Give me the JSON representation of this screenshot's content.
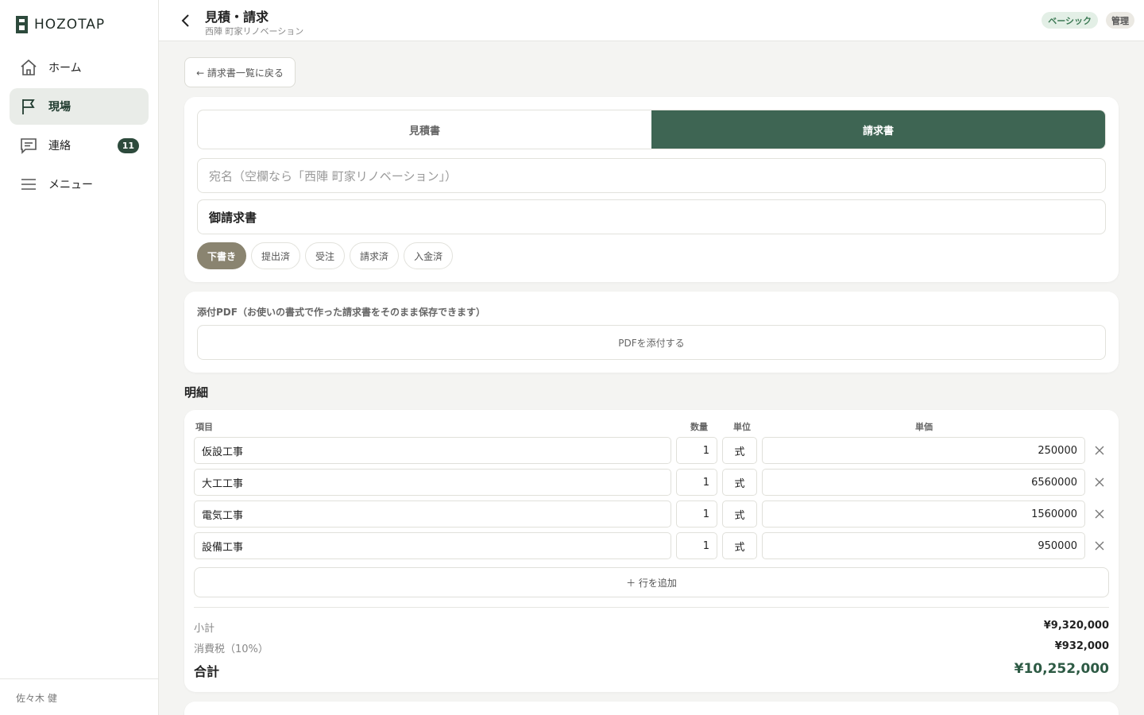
{
  "app": {
    "logo_text": "HOZOTAP"
  },
  "sidebar": {
    "items": [
      {
        "label": "ホーム",
        "icon": "home-icon"
      },
      {
        "label": "現場",
        "icon": "flag-icon",
        "active": true
      },
      {
        "label": "連絡",
        "icon": "chat-icon",
        "badge": "11"
      },
      {
        "label": "メニュー",
        "icon": "menu-icon"
      }
    ],
    "user": "佐々木 健"
  },
  "header": {
    "title": "見積・請求",
    "subtitle": "西陣 町家リノベーション",
    "plan_badge": "ベーシック",
    "admin_badge": "管理"
  },
  "back_to_list": "← 請求書一覧に戻る",
  "doc_tabs": [
    {
      "label": "見積書",
      "active": false
    },
    {
      "label": "請求書",
      "active": true
    }
  ],
  "form": {
    "destination_placeholder": "宛名（空欄なら「西陣 町家リノベーション」）",
    "doc_title": "御請求書",
    "status_chips": [
      {
        "label": "下書き",
        "active": true
      },
      {
        "label": "提出済"
      },
      {
        "label": "受注"
      },
      {
        "label": "請求済"
      },
      {
        "label": "入金済"
      }
    ]
  },
  "pdf": {
    "label": "添付PDF（お使いの書式で作った請求書をそのまま保存できます）",
    "button": "PDFを添付する"
  },
  "details": {
    "section_title": "明細",
    "headers": {
      "item": "項目",
      "qty": "数量",
      "unit": "単位",
      "price": "単価"
    },
    "rows": [
      {
        "name": "仮設工事",
        "qty": "1",
        "unit": "式",
        "price": "250000"
      },
      {
        "name": "大工工事",
        "qty": "1",
        "unit": "式",
        "price": "6560000"
      },
      {
        "name": "電気工事",
        "qty": "1",
        "unit": "式",
        "price": "1560000"
      },
      {
        "name": "設備工事",
        "qty": "1",
        "unit": "式",
        "price": "950000"
      }
    ],
    "add_row": "＋ 行を追加",
    "subtotal_label": "小計",
    "subtotal": "¥9,320,000",
    "tax_label": "消費税（10%）",
    "tax": "¥932,000",
    "total_label": "合計",
    "total": "¥10,252,000"
  },
  "colors": {
    "accent": "#3e6553",
    "chip_active": "#8a8470",
    "total": "#2d5a44"
  }
}
